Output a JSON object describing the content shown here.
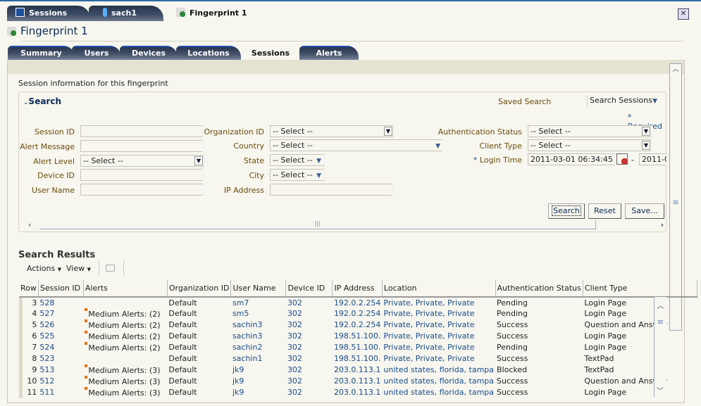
{
  "top_tabs": [
    {
      "label": "Sessions",
      "icon": "sessions-icon"
    },
    {
      "label": "sach1",
      "icon": "user-icon"
    },
    {
      "label": "Fingerprint 1",
      "icon": "fingerprint-icon",
      "active": true
    }
  ],
  "page_title": "Fingerprint 1",
  "sub_tabs": [
    {
      "label": "Summary"
    },
    {
      "label": "Users"
    },
    {
      "label": "Devices"
    },
    {
      "label": "Locations"
    },
    {
      "label": "Sessions",
      "active": true
    },
    {
      "label": "Alerts"
    }
  ],
  "intro": "Session information for this fingerprint",
  "search": {
    "title": "Search",
    "saved_search_label": "Saved Search",
    "saved_search_value": "Search Sessions",
    "required_note": "* Required",
    "fields": {
      "session_id": "Session ID",
      "alert_message": "Alert Message",
      "alert_level": "Alert Level",
      "device_id": "Device ID",
      "user_name": "User Name",
      "organization_id": "Organization ID",
      "country": "Country",
      "state": "State",
      "city": "City",
      "ip_address": "IP Address",
      "auth_status": "Authentication Status",
      "client_type": "Client Type",
      "login_time": "Login Time"
    },
    "select_placeholder": "-- Select --",
    "login_from": "2011-03-01 06:34:45 PM",
    "login_to": "2011-0",
    "login_sep": "-",
    "required_mark": "*",
    "buttons": {
      "search": "Search",
      "reset": "Reset",
      "save": "Save..."
    }
  },
  "results": {
    "title": "Search Results",
    "actions": "Actions",
    "view": "View",
    "columns": [
      "Row",
      "Session ID",
      "Alerts",
      "Organization ID",
      "User Name",
      "Device ID",
      "IP Address",
      "Location",
      "Authentication Status",
      "Client Type"
    ],
    "rows": [
      [
        "3",
        "528",
        "",
        "Default",
        "sm7",
        "302",
        "192.0.2.254",
        "Private, Private, Private",
        "Pending",
        "Login Page"
      ],
      [
        "4",
        "527",
        "Medium Alerts: (2)",
        "Default",
        "sm5",
        "302",
        "192.0.2.254",
        "Private, Private, Private",
        "Pending",
        "Login Page"
      ],
      [
        "5",
        "526",
        "Medium Alerts: (2)",
        "Default",
        "sachin3",
        "302",
        "192.0.2.254",
        "Private, Private, Private",
        "Success",
        "Question and Answer"
      ],
      [
        "6",
        "525",
        "Medium Alerts: (2)",
        "Default",
        "sachin3",
        "302",
        "198.51.100.",
        "Private, Private, Private",
        "Success",
        "Login Page"
      ],
      [
        "7",
        "524",
        "Medium Alerts: (2)",
        "Default",
        "sachin2",
        "302",
        "198.51.100.",
        "Private, Private, Private",
        "Pending",
        "Login Page"
      ],
      [
        "8",
        "523",
        "",
        "Default",
        "sachin1",
        "302",
        "198.51.100.",
        "Private, Private, Private",
        "Success",
        "TextPad"
      ],
      [
        "9",
        "513",
        "Medium Alerts: (3)",
        "Default",
        "jk9",
        "302",
        "203.0.113.1",
        "united states, florida, tampa",
        "Blocked",
        "TextPad"
      ],
      [
        "10",
        "512",
        "Medium Alerts: (3)",
        "Default",
        "jk9",
        "302",
        "203.0.113.1",
        "united states, florida, tampa",
        "Success",
        "Question and Answer"
      ],
      [
        "11",
        "511",
        "Medium Alerts: (3)",
        "Default",
        "jk9",
        "302",
        "203.0.113.1",
        "united states, florida, tampa",
        "Success",
        "Login Page"
      ]
    ]
  },
  "colors": {
    "alert_marker": "#f07000",
    "link": "#1a4c8c",
    "label": "#6b4c0e"
  }
}
